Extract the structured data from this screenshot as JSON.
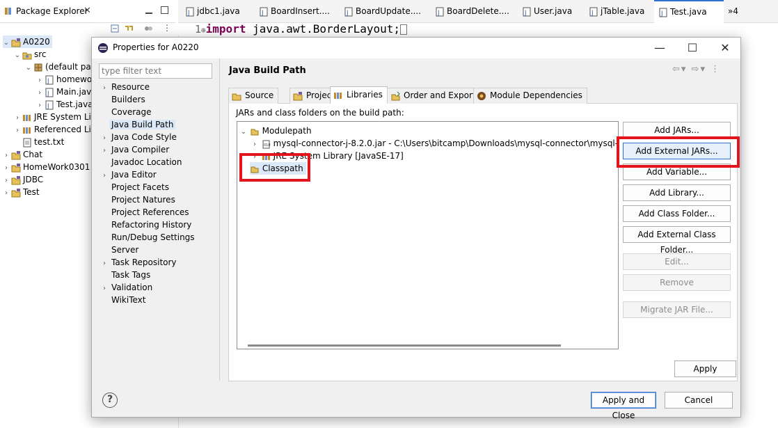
{
  "package_explorer": {
    "title": "Package Explorer",
    "tree": [
      {
        "label": "A0220",
        "level": 0,
        "chev": "⌄",
        "icon": "project-icon",
        "selected": true
      },
      {
        "label": "src",
        "level": 1,
        "chev": "⌄",
        "icon": "source-folder-icon"
      },
      {
        "label": "(default pac",
        "level": 2,
        "chev": "⌄",
        "icon": "package-icon"
      },
      {
        "label": "homewo",
        "level": 3,
        "chev": "›",
        "icon": "java-file-icon"
      },
      {
        "label": "Main.java",
        "level": 3,
        "chev": "›",
        "icon": "java-file-icon"
      },
      {
        "label": "Test.java",
        "level": 3,
        "chev": "›",
        "icon": "java-file-icon"
      },
      {
        "label": "JRE System Lib",
        "level": 1,
        "chev": "›",
        "icon": "library-icon"
      },
      {
        "label": "Referenced Lib",
        "level": 1,
        "chev": "›",
        "icon": "library-icon"
      },
      {
        "label": "test.txt",
        "level": 1,
        "chev": "",
        "icon": "text-file-icon"
      },
      {
        "label": "Chat",
        "level": 0,
        "chev": "›",
        "icon": "project-icon"
      },
      {
        "label": "HomeWork0301",
        "level": 0,
        "chev": "›",
        "icon": "project-icon"
      },
      {
        "label": "JDBC",
        "level": 0,
        "chev": "›",
        "icon": "project-icon"
      },
      {
        "label": "Test",
        "level": 0,
        "chev": "›",
        "icon": "project-icon"
      }
    ]
  },
  "editor": {
    "tabs": [
      "jdbc1.java",
      "BoardInsert....",
      "BoardUpdate....",
      "BoardDelete....",
      "User.java",
      "jTable.java",
      "Test.java"
    ],
    "active_tab": "Test.java",
    "overflow": "»4",
    "line_number": "1",
    "fold_marker": "⊕",
    "keyword": "import",
    "code_rest": " java.awt.BorderLayout;"
  },
  "dialog": {
    "title": "Properties for A0220",
    "filter_placeholder": "type filter text",
    "categories": [
      {
        "label": "Resource",
        "chev": "›"
      },
      {
        "label": "Builders",
        "chev": ""
      },
      {
        "label": "Coverage",
        "chev": ""
      },
      {
        "label": "Java Build Path",
        "chev": "",
        "selected": true
      },
      {
        "label": "Java Code Style",
        "chev": "›"
      },
      {
        "label": "Java Compiler",
        "chev": "›"
      },
      {
        "label": "Javadoc Location",
        "chev": ""
      },
      {
        "label": "Java Editor",
        "chev": "›"
      },
      {
        "label": "Project Facets",
        "chev": ""
      },
      {
        "label": "Project Natures",
        "chev": ""
      },
      {
        "label": "Project References",
        "chev": ""
      },
      {
        "label": "Refactoring History",
        "chev": ""
      },
      {
        "label": "Run/Debug Settings",
        "chev": ""
      },
      {
        "label": "Server",
        "chev": ""
      },
      {
        "label": "Task Repository",
        "chev": "›"
      },
      {
        "label": "Task Tags",
        "chev": ""
      },
      {
        "label": "Validation",
        "chev": "›"
      },
      {
        "label": "WikiText",
        "chev": ""
      }
    ],
    "page_title": "Java Build Path",
    "tabs": [
      {
        "label": "Source",
        "icon": "source-icon"
      },
      {
        "label": "Projects",
        "icon": "projects-icon"
      },
      {
        "label": "Libraries",
        "icon": "libraries-icon",
        "active": true
      },
      {
        "label": "Order and Export",
        "icon": "order-export-icon"
      },
      {
        "label": "Module Dependencies",
        "icon": "module-icon"
      }
    ],
    "jars_label": "JARs and class folders on the build path:",
    "build_tree": {
      "modulepath": "Modulepath",
      "jar": "mysql-connector-j-8.2.0.jar - C:\\Users\\bitcamp\\Downloads\\mysql-connector\\mysql-con",
      "jre": "JRE System Library [JavaSE-17]",
      "classpath": "Classpath"
    },
    "buttons": {
      "add_jars": "Add JARs...",
      "add_external_jars": "Add External JARs...",
      "add_variable": "Add Variable...",
      "add_library": "Add Library...",
      "add_class_folder": "Add Class Folder...",
      "add_external_class_folder": "Add External Class Folder...",
      "edit": "Edit...",
      "remove": "Remove",
      "migrate_jar": "Migrate JAR File...",
      "apply": "Apply",
      "apply_and_close": "Apply and Close",
      "cancel": "Cancel"
    },
    "help": "?",
    "window_buttons": {
      "minimize": "—",
      "maximize": "☐",
      "close": "✕"
    }
  },
  "colors": {
    "highlight_box": "#e3141b",
    "selection": "#dbe8f7",
    "keyword": "#7f0055"
  }
}
